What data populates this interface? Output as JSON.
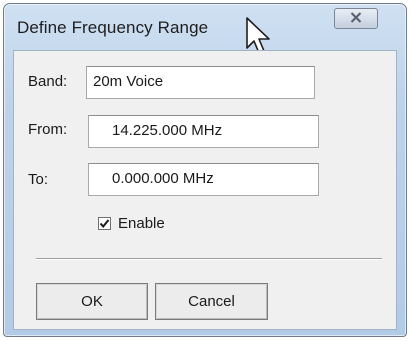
{
  "window": {
    "title": "Define Frequency Range",
    "close_icon": "close-icon"
  },
  "form": {
    "band_label": "Band:",
    "band_value": "20m Voice",
    "from_label": "From:",
    "from_value": "14.225.000 MHz",
    "to_label": "To:",
    "to_value": "0.000.000 MHz",
    "enable_label": "Enable",
    "enable_checked": true
  },
  "buttons": {
    "ok_label": "OK",
    "cancel_label": "Cancel"
  }
}
